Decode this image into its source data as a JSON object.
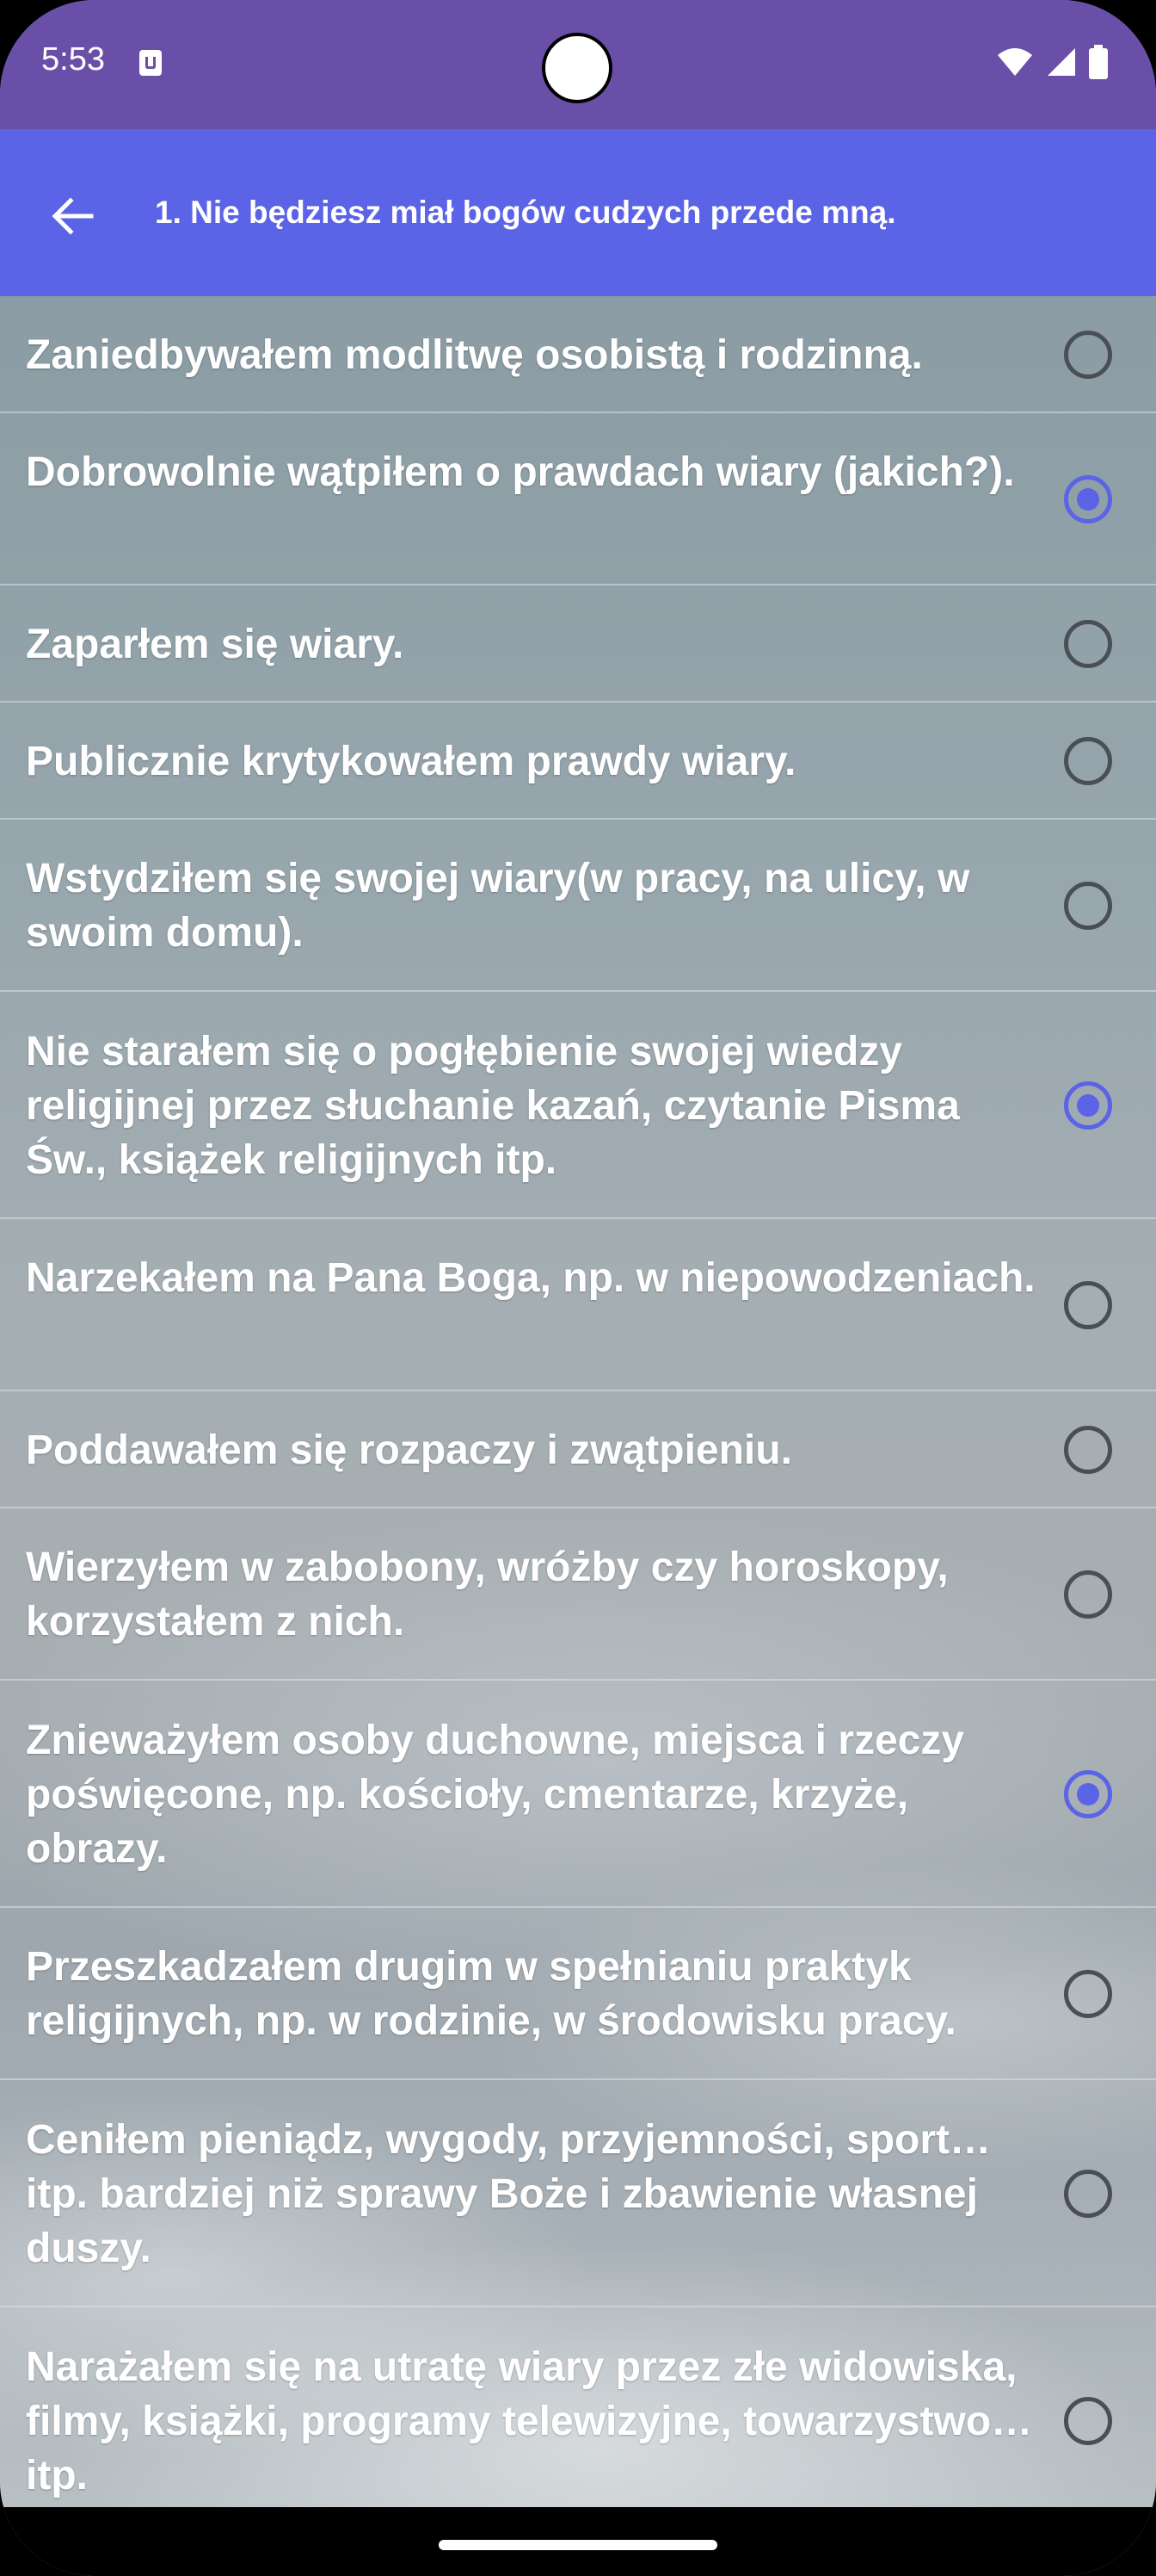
{
  "status": {
    "time": "5:53"
  },
  "appbar": {
    "title": "1. Nie będziesz miał bogów cudzych przede mną."
  },
  "accent_color": "#5b63e6",
  "items": [
    {
      "text": "Zaniedbywałem modlitwę osobistą i rodzinną.",
      "checked": false
    },
    {
      "text": "Dobrowolnie wątpiłem o prawdach wiary (jakich?).",
      "checked": true
    },
    {
      "text": "Zaparłem się wiary.",
      "checked": false
    },
    {
      "text": "Publicznie krytykowałem prawdy wiary.",
      "checked": false
    },
    {
      "text": "Wstydziłem się swojej wiary(w pracy, na ulicy, w swoim domu).",
      "checked": false
    },
    {
      "text": "Nie starałem się o pogłębienie swojej wiedzy religijnej przez słuchanie kazań, czytanie Pisma Św., książek religijnych itp.",
      "checked": true
    },
    {
      "text": "Narzekałem na Pana Boga, np. w niepowodzeniach.",
      "checked": false
    },
    {
      "text": "Poddawałem się rozpaczy i zwątpieniu.",
      "checked": false
    },
    {
      "text": "Wierzyłem w zabobony, wróżby czy horoskopy, korzystałem z nich.",
      "checked": false
    },
    {
      "text": "Znieważyłem osoby duchowne, miejsca i rzeczy poświęcone, np. kościoły, cmentarze, krzyże, obrazy.",
      "checked": true
    },
    {
      "text": "Przeszkadzałem drugim w spełnianiu praktyk religijnych, np. w rodzinie, w środowisku pracy.",
      "checked": false
    },
    {
      "text": "Ceniłem pieniądz, wygody, przyjemności, sport… itp. bardziej niż sprawy Boże i zbawienie własnej duszy.",
      "checked": false
    },
    {
      "text": "Narażałem się na utratę wiary przez złe widowiska, filmy, książki, programy telewizyjne, towarzystwo… itp.",
      "checked": false
    }
  ]
}
